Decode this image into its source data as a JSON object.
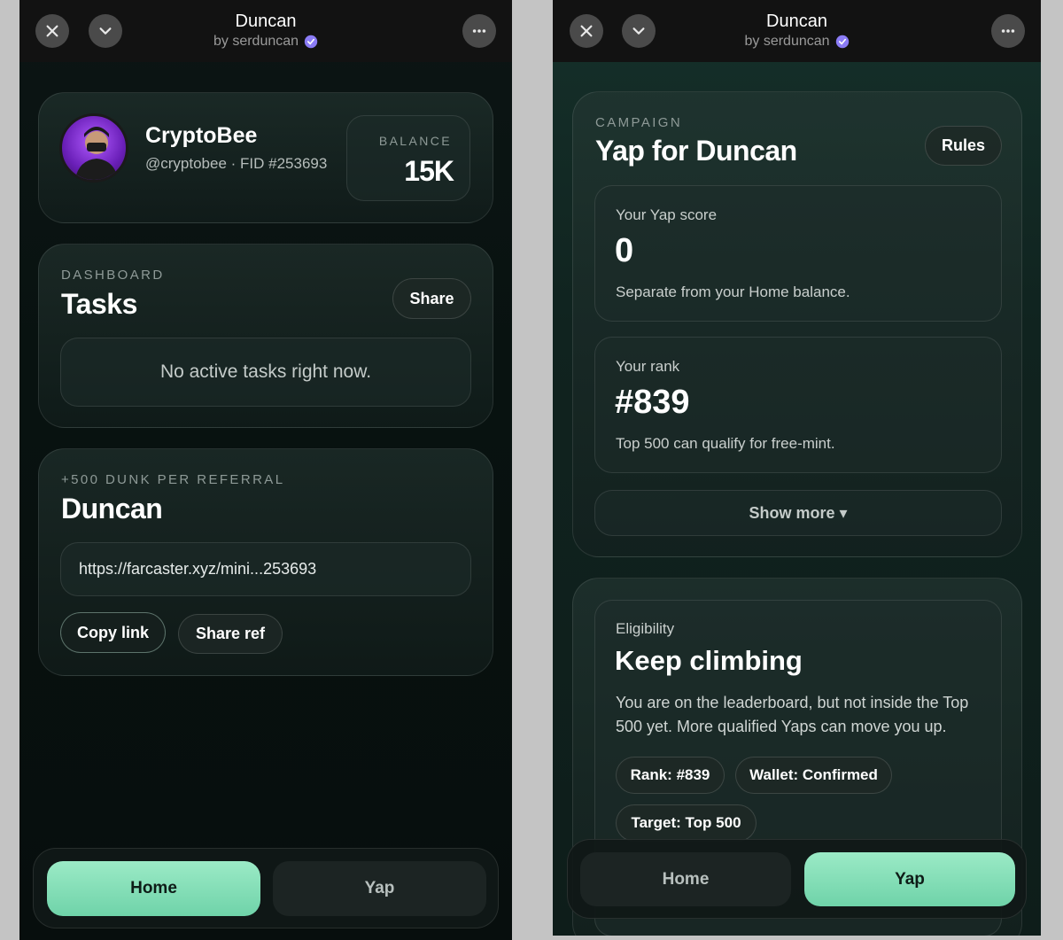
{
  "header": {
    "title": "Duncan",
    "subtitle": "by serduncan"
  },
  "icons": {
    "close": "close-icon",
    "collapse": "chevron-down-icon",
    "more": "more-icon",
    "verified": "verified-badge-icon"
  },
  "colors": {
    "accent": "#7fdcb5",
    "verified": "#8b7cf6",
    "topbar": "#121212"
  },
  "home": {
    "profile": {
      "name": "CryptoBee",
      "handle": "@cryptobee · FID #253693",
      "balance_label": "BALANCE",
      "balance_value": "15K"
    },
    "tasks": {
      "eyebrow": "DASHBOARD",
      "title": "Tasks",
      "share_label": "Share",
      "empty_text": "No active tasks right now."
    },
    "referral": {
      "eyebrow": "+500 DUNK PER REFERRAL",
      "title": "Duncan",
      "link": "https://farcaster.xyz/mini...253693",
      "copy_label": "Copy link",
      "share_label": "Share ref"
    }
  },
  "yap": {
    "campaign": {
      "eyebrow": "CAMPAIGN",
      "title": "Yap for Duncan",
      "rules_label": "Rules",
      "score_label": "Your Yap score",
      "score_value": "0",
      "score_note": "Separate from your Home balance.",
      "rank_label": "Your rank",
      "rank_value": "#839",
      "rank_note": "Top 500 can qualify for free-mint.",
      "show_more_label": "Show more ▾"
    },
    "eligibility": {
      "label": "Eligibility",
      "title": "Keep climbing",
      "description_line1": "You are on the leaderboard, but not inside the Top",
      "description_line2": "500 yet. More qualified Yaps can move you up.",
      "badges": [
        "Rank: #839",
        "Wallet: Confirmed",
        "Target: Top 500"
      ]
    }
  },
  "tabs": {
    "home": "Home",
    "yap": "Yap",
    "active_left": "Home",
    "active_right": "Yap"
  }
}
